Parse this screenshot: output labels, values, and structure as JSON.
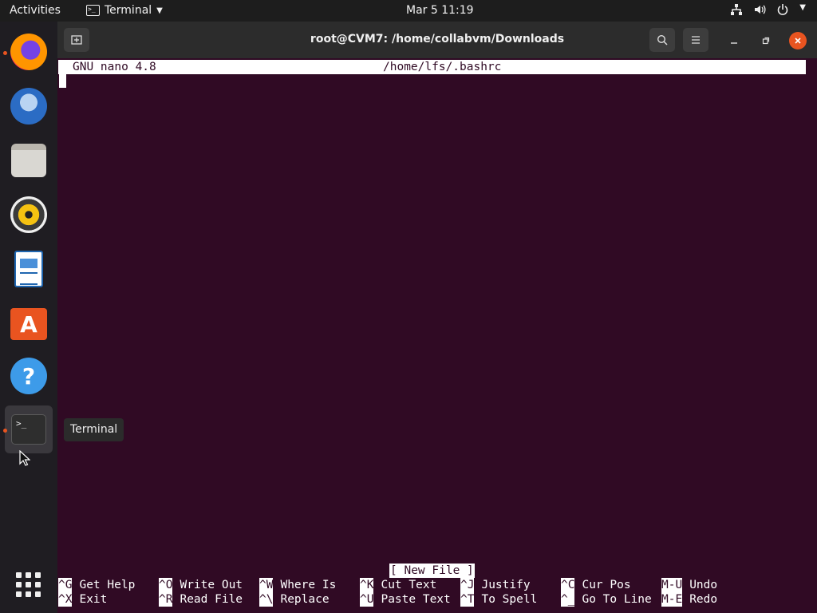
{
  "topbar": {
    "activities": "Activities",
    "app_name": "Terminal",
    "clock": "Mar 5  11:19"
  },
  "dock": {
    "items": [
      "firefox-icon",
      "thunderbird-icon",
      "files-icon",
      "rhythmbox-icon",
      "libreoffice-writer-icon",
      "ubuntu-software-icon",
      "help-icon",
      "terminal-icon"
    ],
    "tooltip": "Terminal"
  },
  "window": {
    "title": "root@CVM7: /home/collabvm/Downloads"
  },
  "nano": {
    "version": "GNU nano 4.8",
    "filename": "/home/lfs/.bashrc",
    "status": "[ New File ]",
    "shortcuts_row1": [
      {
        "key": "^G",
        "label": "Get Help"
      },
      {
        "key": "^O",
        "label": "Write Out"
      },
      {
        "key": "^W",
        "label": "Where Is"
      },
      {
        "key": "^K",
        "label": "Cut Text"
      },
      {
        "key": "^J",
        "label": "Justify"
      },
      {
        "key": "^C",
        "label": "Cur Pos"
      },
      {
        "key": "M-U",
        "label": "Undo"
      }
    ],
    "shortcuts_row2": [
      {
        "key": "^X",
        "label": "Exit"
      },
      {
        "key": "^R",
        "label": "Read File"
      },
      {
        "key": "^\\",
        "label": "Replace"
      },
      {
        "key": "^U",
        "label": "Paste Text"
      },
      {
        "key": "^T",
        "label": "To Spell"
      },
      {
        "key": "^_",
        "label": "Go To Line"
      },
      {
        "key": "M-E",
        "label": "Redo"
      }
    ]
  },
  "colors": {
    "terminal_bg": "#300a24",
    "accent": "#e95420",
    "topbar_bg": "#1d1d1d"
  }
}
